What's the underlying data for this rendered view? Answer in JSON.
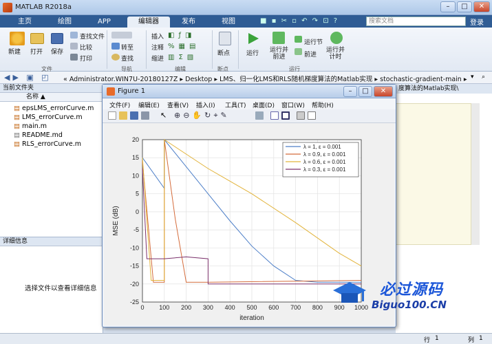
{
  "app": {
    "title": "MATLAB R2018a"
  },
  "tabs": [
    "主页",
    "绘图",
    "APP",
    "编辑器",
    "发布",
    "视图"
  ],
  "search": {
    "placeholder": "搜索文档"
  },
  "login": "登录",
  "ribbon": {
    "file": {
      "new": "新建",
      "open": "打开",
      "save": "保存",
      "find_files": "查找文件",
      "compare": "比较",
      "print": "打印",
      "group": "文件"
    },
    "nav": {
      "goto": "转至",
      "find": "查找",
      "group": "导航"
    },
    "edit": {
      "insert": "插入",
      "comment": "注释",
      "indent": "缩进",
      "group": "编辑"
    },
    "breakpoints": {
      "label": "断点",
      "group": "断点"
    },
    "run": {
      "run": "运行",
      "run_advance": "运行并\n前进",
      "run_section": "运行节",
      "advance": "前进",
      "run_time": "运行并\n计时",
      "group": "运行"
    }
  },
  "path": "« Administrator.WIN7U-20180127Z  ▸  Desktop  ▸  LMS、归一化LMS和RLS随机梯度算法的Matlab实现  ▸  stochastic-gradient-main  ▸",
  "current_folder": {
    "header": "当前文件夹",
    "col_name": "名称 ▲",
    "files": [
      "epsLMS_errorCurve.m",
      "LMS_errorCurve.m",
      "main.m",
      "README.md",
      "RLS_errorCurve.m"
    ]
  },
  "detail": {
    "header": "详细信息",
    "message": "选择文件以查看详细信息"
  },
  "right_snip": "度算法的Matlab实现\\",
  "status": {
    "row": "行",
    "col": "列",
    "row_val": "1",
    "col_val": "1"
  },
  "figure": {
    "title": "Figure 1",
    "menu": [
      "文件(F)",
      "编辑(E)",
      "查看(V)",
      "插入(I)",
      "工具(T)",
      "桌面(D)",
      "窗口(W)",
      "帮助(H)"
    ]
  },
  "watermark": {
    "brand": "必过源码",
    "url": "Biguo100.CN"
  },
  "chart_data": {
    "type": "line",
    "xlabel": "iteration",
    "ylabel": "MSE (dB)",
    "xlim": [
      0,
      1000
    ],
    "ylim": [
      -25,
      20
    ],
    "xticks": [
      0,
      100,
      200,
      300,
      400,
      500,
      600,
      700,
      800,
      900,
      1000
    ],
    "yticks": [
      20,
      15,
      10,
      5,
      0,
      -5,
      -10,
      -15,
      -20,
      -25
    ],
    "grid": true,
    "legend_position": "top-right",
    "series": [
      {
        "name": "λ = 1, ε = 0.001",
        "color": "#4d7fc8",
        "x": [
          0,
          100,
          100,
          200,
          300,
          400,
          500,
          600,
          700,
          800,
          1000
        ],
        "y": [
          15,
          6.5,
          20,
          12.5,
          5,
          -2.5,
          -9.5,
          -15,
          -19,
          -19.5,
          -19.5
        ]
      },
      {
        "name": "λ = 0.9, ε = 0.001",
        "color": "#d46b3a",
        "x": [
          0,
          50,
          100,
          100,
          150,
          200,
          300,
          1000
        ],
        "y": [
          14,
          -19.5,
          -19.5,
          20,
          -2,
          -19.5,
          -19.5,
          -19
        ]
      },
      {
        "name": "λ = 0.6, ε = 0.001",
        "color": "#e2b33a",
        "x": [
          0,
          40,
          100,
          100,
          300,
          500,
          700,
          900,
          1000
        ],
        "y": [
          15,
          -19,
          -19,
          20,
          12,
          5,
          -3,
          -11.5,
          -15
        ]
      },
      {
        "name": "λ = 0.3, ε = 0.001",
        "color": "#7a2f6a",
        "x": [
          0,
          20,
          100,
          200,
          300,
          300,
          1000
        ],
        "y": [
          12,
          -13,
          -13,
          -12.5,
          -13,
          -20,
          -20
        ]
      }
    ]
  }
}
